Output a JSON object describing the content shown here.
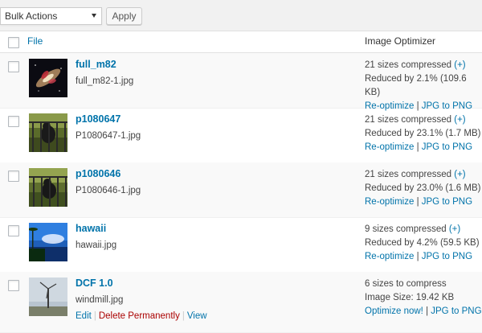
{
  "toolbar": {
    "bulk_actions": "Bulk Actions",
    "apply": "Apply"
  },
  "columns": {
    "file": "File",
    "optimizer": "Image Optimizer"
  },
  "rows": [
    {
      "title": "full_m82",
      "filename": "full_m82-1.jpg",
      "line1": "21 sizes compressed",
      "plus": "(+)",
      "line2": "Reduced by 2.1% (109.6 KB)",
      "action1": "Re-optimize",
      "sep": "|",
      "action2": "JPG to PNG"
    },
    {
      "title": "p1080647",
      "filename": "P1080647-1.jpg",
      "line1": "21 sizes compressed",
      "plus": "(+)",
      "line2": "Reduced by 23.1% (1.7 MB)",
      "action1": "Re-optimize",
      "sep": "|",
      "action2": "JPG to PNG"
    },
    {
      "title": "p1080646",
      "filename": "P1080646-1.jpg",
      "line1": "21 sizes compressed",
      "plus": "(+)",
      "line2": "Reduced by 23.0% (1.6 MB)",
      "action1": "Re-optimize",
      "sep": "|",
      "action2": "JPG to PNG"
    },
    {
      "title": "hawaii",
      "filename": "hawaii.jpg",
      "line1": "9 sizes compressed",
      "plus": "(+)",
      "line2": "Reduced by 4.2% (59.5 KB)",
      "action1": "Re-optimize",
      "sep": "|",
      "action2": "JPG to PNG"
    },
    {
      "title": "DCF 1.0",
      "filename": "windmill.jpg",
      "line1": "6 sizes to compress",
      "line2": "Image Size: 19.42 KB",
      "action1": "Optimize now!",
      "sep": "|",
      "action2": "JPG to PNG",
      "row_actions": {
        "edit": "Edit",
        "delete": "Delete Permanently",
        "view": "View",
        "sep": "|"
      }
    }
  ]
}
